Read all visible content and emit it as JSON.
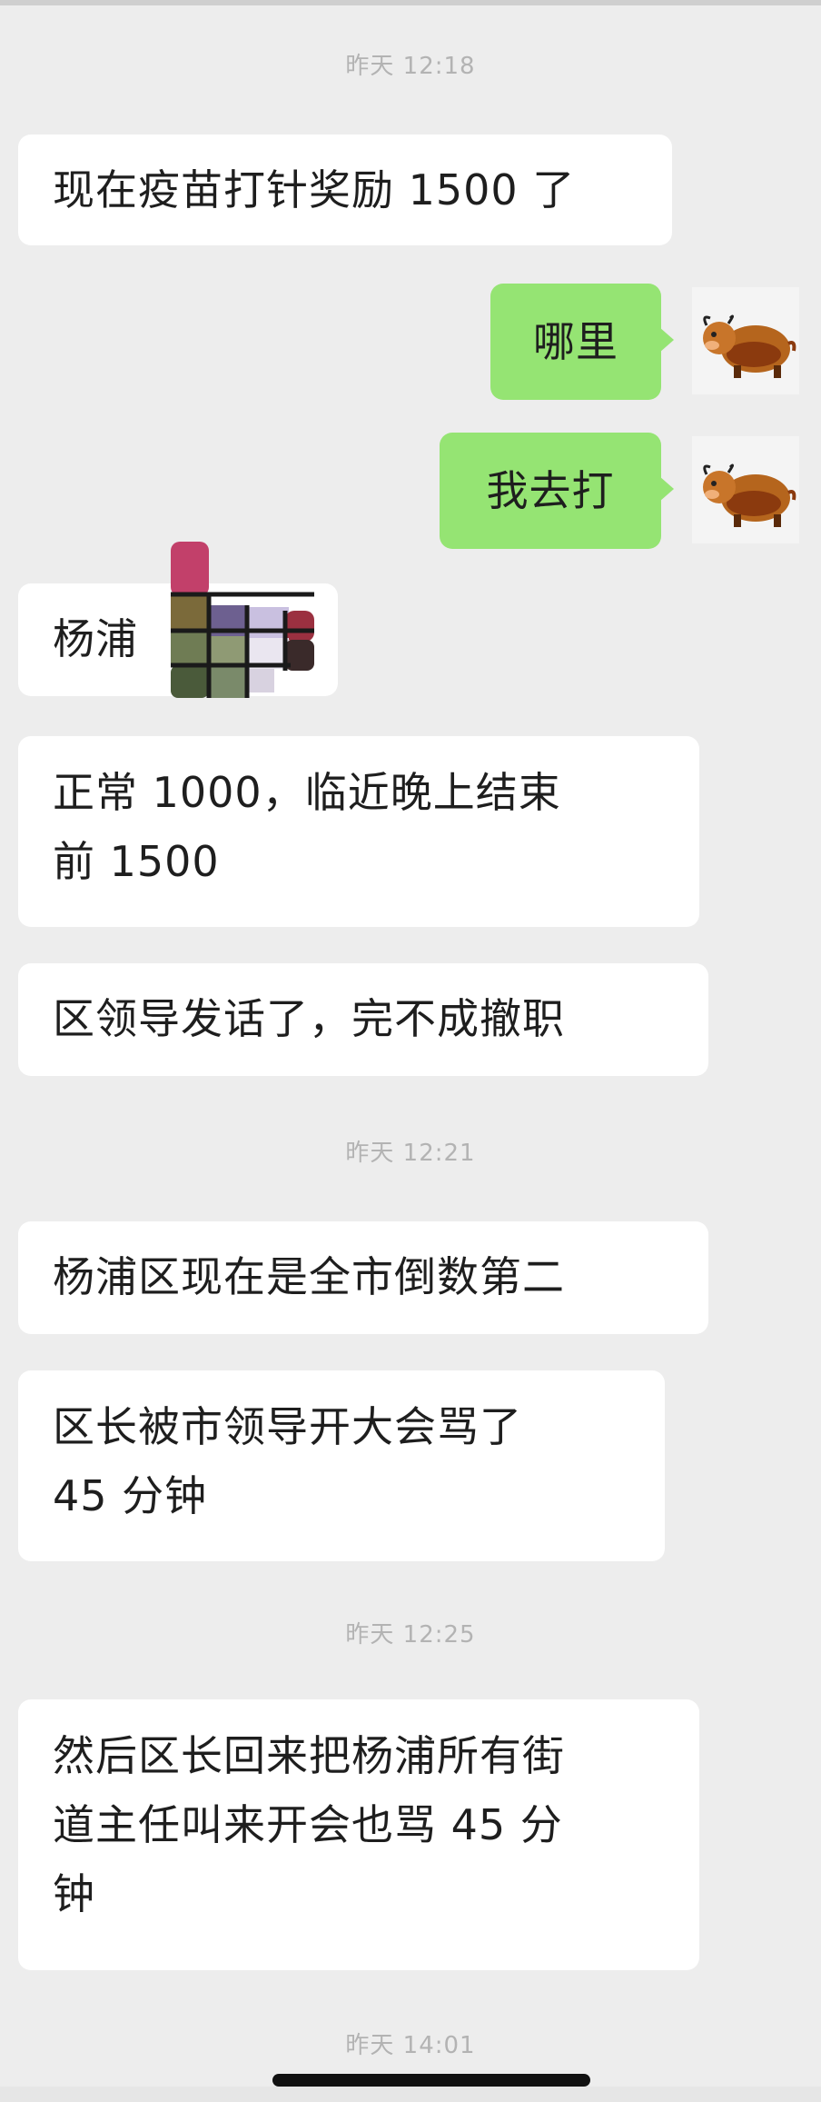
{
  "chat": {
    "timestamps": [
      "昨天 12:18",
      "昨天 12:21",
      "昨天 12:25",
      "昨天 14:01"
    ],
    "messages": [
      {
        "from": "them",
        "text": "现在疫苗打针奖励 1500 了"
      },
      {
        "from": "me",
        "text": "哪里"
      },
      {
        "from": "me",
        "text": "我去打"
      },
      {
        "from": "them",
        "text": "杨浦"
      },
      {
        "from": "them",
        "lines": [
          "正常 1000，临近晚上结束",
          "前 1500"
        ]
      },
      {
        "from": "them",
        "text": "区领导发话了，完不成撤职"
      },
      {
        "from": "them",
        "text": "杨浦区现在是全市倒数第二"
      },
      {
        "from": "them",
        "lines": [
          "区长被市领导开大会骂了",
          "45 分钟"
        ]
      },
      {
        "from": "them",
        "lines": [
          "然后区长回来把杨浦所有街",
          "道主任叫来开会也骂 45 分",
          "钟"
        ]
      }
    ]
  },
  "colors": {
    "background": "#ededed",
    "incoming_bubble": "#ffffff",
    "outgoing_bubble": "#95e473",
    "timestamp": "#b3b3b3"
  },
  "icons": {
    "avatar": "cartoon-ox-avatar",
    "redaction": "mosaic-redaction"
  }
}
